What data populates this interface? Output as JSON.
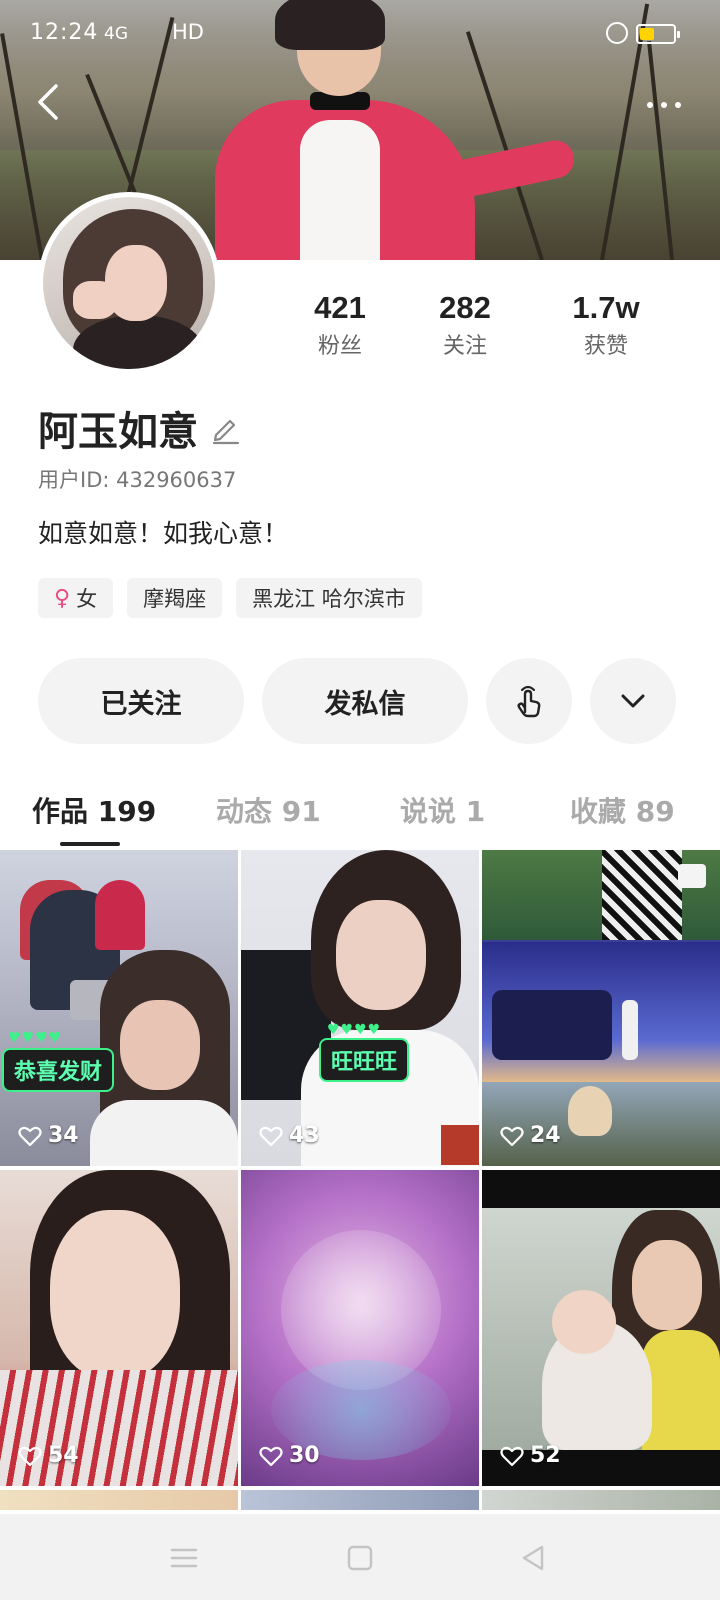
{
  "status_bar": {
    "time": "12:24",
    "signal": "4G",
    "wifi": "HD",
    "battery_color": "#ffd400"
  },
  "nav": {
    "back_icon": "chevron-left-icon",
    "more_icon": "more-horizontal-icon"
  },
  "profile": {
    "stats": [
      {
        "value": "421",
        "label": "粉丝"
      },
      {
        "value": "282",
        "label": "关注"
      },
      {
        "value": "1.7w",
        "label": "获赞"
      }
    ],
    "name": "阿玉如意",
    "user_id": "用户ID: 432960637",
    "bio": "如意如意！如我心意！",
    "tags": {
      "gender": "女",
      "zodiac": "摩羯座",
      "location": "黑龙江 哈尔滨市"
    },
    "gender_color": "#e94b84"
  },
  "actions": {
    "follow": "已关注",
    "message": "发私信",
    "poke_icon": "tap-hand-icon",
    "expand_icon": "chevron-down-icon"
  },
  "tabs": [
    {
      "label": "作品 199",
      "active": true
    },
    {
      "label": "动态 91",
      "active": false
    },
    {
      "label": "说说 1",
      "active": false
    },
    {
      "label": "收藏 89",
      "active": false
    }
  ],
  "grid": {
    "items": [
      {
        "likes": "34",
        "sticker": "恭喜发财"
      },
      {
        "likes": "43",
        "sticker": "旺旺旺"
      },
      {
        "likes": "24"
      },
      {
        "likes": "54"
      },
      {
        "likes": "30"
      },
      {
        "likes": "52"
      }
    ],
    "sticker_color": "#3ef08a"
  },
  "system_nav": {
    "menu_icon": "menu-icon",
    "home_icon": "home-square-icon",
    "back_icon": "back-triangle-icon"
  }
}
